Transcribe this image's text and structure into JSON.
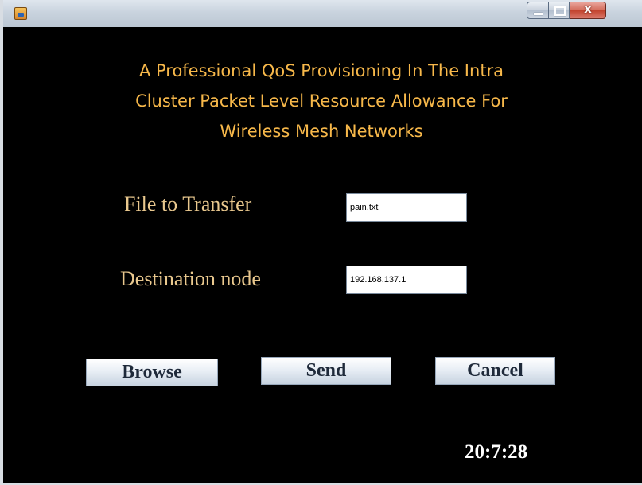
{
  "window": {
    "title": "",
    "controls": {
      "minimize": "minimize",
      "maximize": "maximize",
      "close": "close"
    }
  },
  "heading": {
    "line1": "A  Professional QoS Provisioning In The Intra",
    "line2": "Cluster Packet Level Resource Allowance For",
    "line3": "Wireless Mesh Networks"
  },
  "form": {
    "file_label": "File to Transfer",
    "file_value": "pain.txt",
    "dest_label": "Destination node",
    "dest_value": "192.168.137.1"
  },
  "buttons": {
    "browse": "Browse",
    "send": "Send",
    "cancel": "Cancel"
  },
  "clock": "20:7:28",
  "colors": {
    "background": "#000000",
    "heading": "#f7b84a",
    "label": "#e9c88e",
    "clock": "#ffffff"
  },
  "icons": {
    "app": "java-cup-icon",
    "minimize": "minimize-icon",
    "maximize": "maximize-icon",
    "close": "close-icon"
  }
}
